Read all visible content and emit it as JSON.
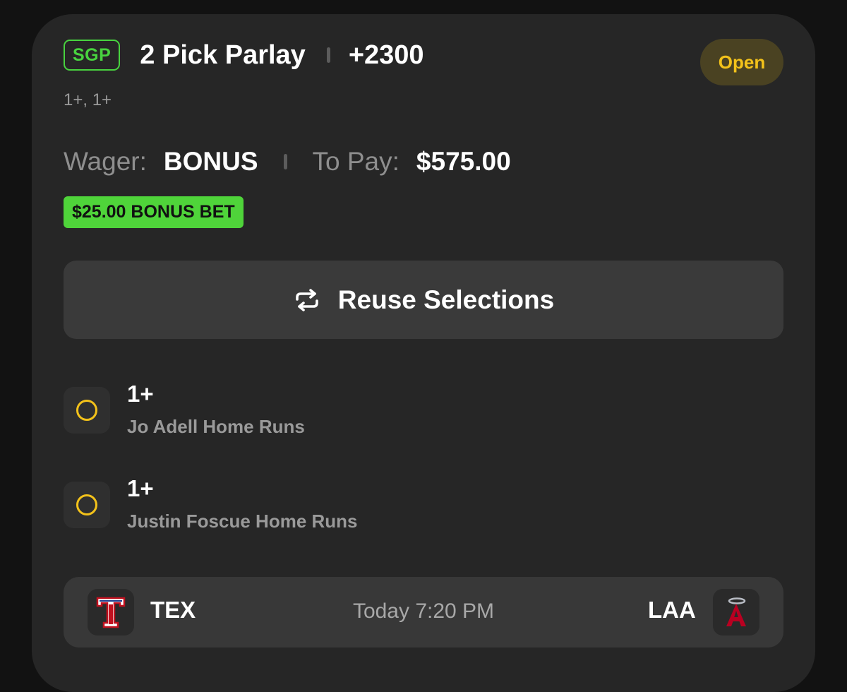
{
  "bet": {
    "badge": "SGP",
    "title": "2 Pick Parlay",
    "odds": "+2300",
    "status": "Open",
    "leg_summary": "1+, 1+"
  },
  "wager": {
    "wager_label": "Wager:",
    "wager_value": "BONUS",
    "pay_label": "To Pay:",
    "pay_value": "$575.00",
    "bonus_badge": "$25.00 BONUS BET"
  },
  "reuse": {
    "label": "Reuse Selections",
    "icon": "repeat-icon"
  },
  "legs": [
    {
      "line": "1+",
      "market": "Jo Adell Home Runs",
      "status_icon": "pending-circle-icon"
    },
    {
      "line": "1+",
      "market": "Justin Foscue Home Runs",
      "status_icon": "pending-circle-icon"
    }
  ],
  "game": {
    "away_team": "TEX",
    "home_team": "LAA",
    "time": "Today 7:20 PM",
    "away_logo": "rangers-logo-icon",
    "home_logo": "angels-logo-icon"
  },
  "colors": {
    "background": "#121212",
    "card": "#262626",
    "green_accent": "#48d33f",
    "bonus_green": "#4fd43a",
    "open_text": "#f3c21a",
    "open_bg": "#4a4222",
    "button_bg": "#3a3a3a"
  }
}
